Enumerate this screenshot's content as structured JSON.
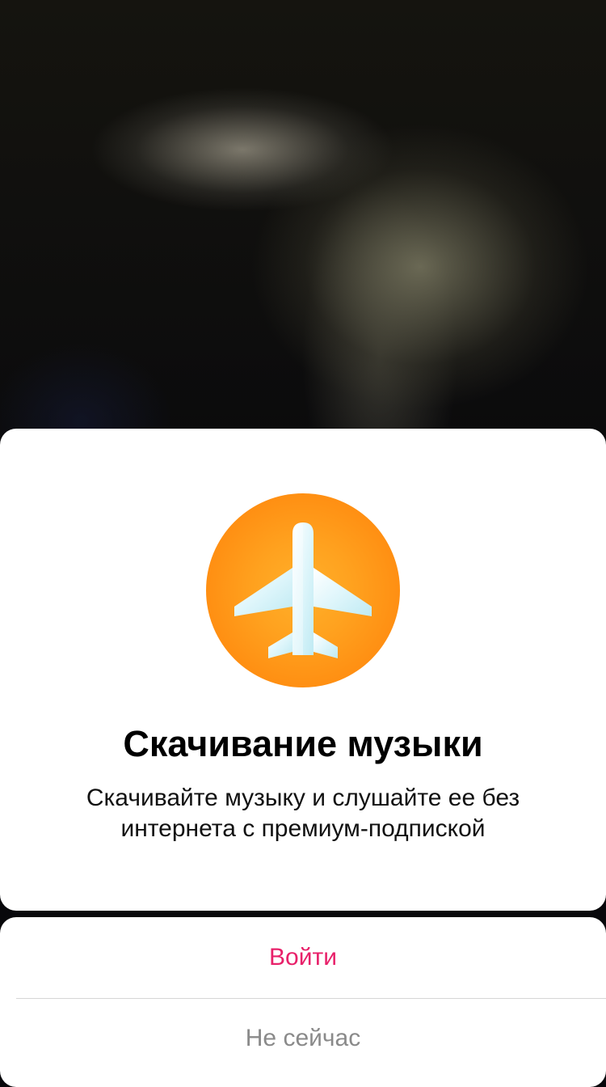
{
  "dialog": {
    "icon": "airplane-icon",
    "title": "Скачивание музыки",
    "message_line1": "Скачивайте музыку и слушайте ее без",
    "message_line2": "интернета с премиум-подпиской"
  },
  "actions": {
    "login_label": "Войти",
    "later_label": "Не сейчас"
  },
  "colors": {
    "accent": "#e8216a",
    "icon_bg": "#ff8a0f",
    "secondary_text": "#8a8a8a"
  }
}
